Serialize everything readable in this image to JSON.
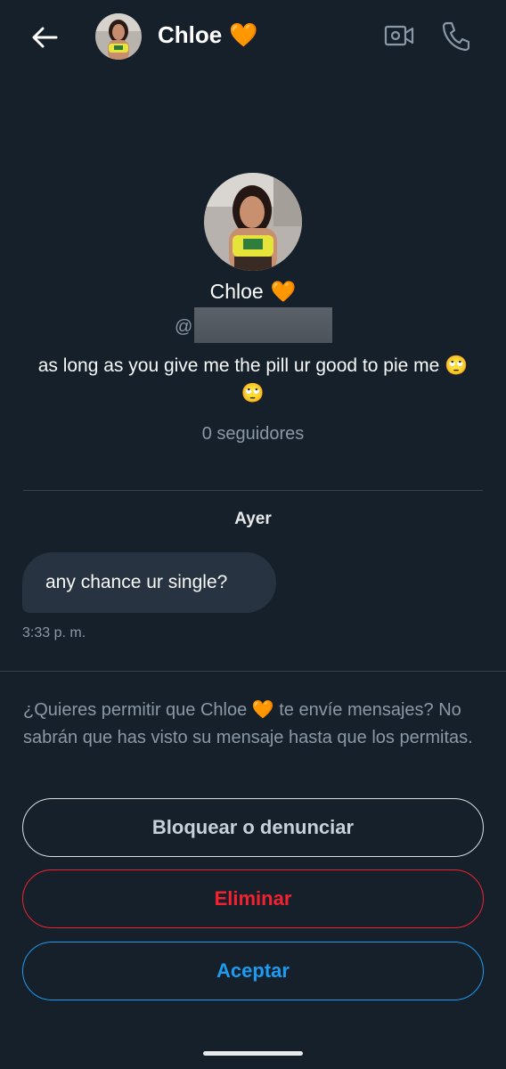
{
  "header": {
    "name": "Chloe",
    "name_emoji": "🧡"
  },
  "profile": {
    "name": "Chloe",
    "name_emoji": "🧡",
    "handle_prefix": "@",
    "bio": "as long as you give me the pill ur good to pie me 🙄🙄",
    "followers": "0 seguidores"
  },
  "conversation": {
    "date_label": "Ayer",
    "messages": [
      {
        "text": "any chance ur single?",
        "time": "3:33 p. m."
      }
    ]
  },
  "request": {
    "text": "¿Quieres permitir que Chloe 🧡 te envíe mensajes? No sabrán que has visto su mensaje hasta que los permitas."
  },
  "actions": {
    "block_label": "Bloquear o denunciar",
    "delete_label": "Eliminar",
    "accept_label": "Aceptar"
  },
  "colors": {
    "background": "#15202b",
    "accent": "#1d9bf0",
    "danger": "#f4212e",
    "secondary_text": "#8b98a5"
  },
  "icons": {
    "back": "arrow-left-icon",
    "video": "video-camera-icon",
    "call": "phone-icon"
  }
}
